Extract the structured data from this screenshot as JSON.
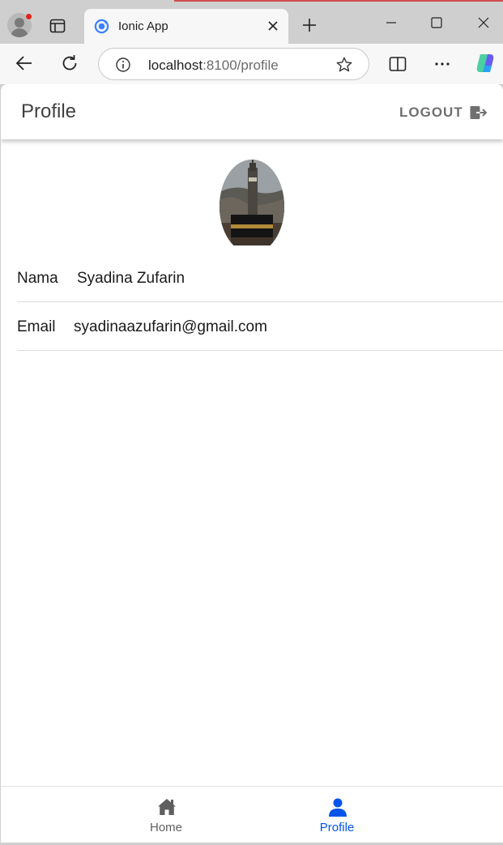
{
  "browser": {
    "tab_title": "Ionic App",
    "url_host": "localhost",
    "url_path": ":8100/profile"
  },
  "header": {
    "title": "Profile",
    "logout_label": "LOGOUT"
  },
  "profile": {
    "fields": [
      {
        "label": "Nama",
        "value": "Syadina Zufarin"
      },
      {
        "label": "Email",
        "value": "syadinaazufarin@gmail.com"
      }
    ]
  },
  "tabbar": {
    "tabs": [
      {
        "label": "Home",
        "icon": "home-icon",
        "selected": false
      },
      {
        "label": "Profile",
        "icon": "person-icon",
        "selected": true
      }
    ]
  },
  "colors": {
    "accent": "#0054e9",
    "inactive_tab": "#5f5f5f",
    "header_text": "#404040"
  }
}
